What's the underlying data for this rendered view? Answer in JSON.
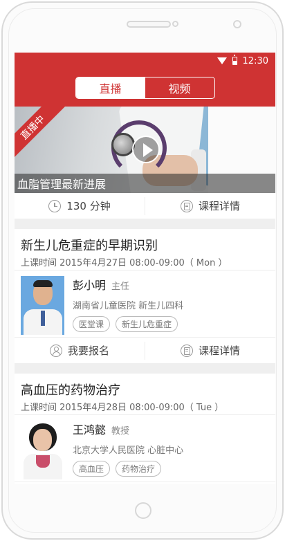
{
  "status_bar": {
    "time": "12:30"
  },
  "header": {
    "tabs": [
      {
        "label": "直播"
      },
      {
        "label": "视频"
      }
    ]
  },
  "banner": {
    "live_badge": "直播中",
    "caption": "血脂管理最新进展"
  },
  "banner_actions": {
    "duration": "130 分钟",
    "details": "课程详情"
  },
  "courses": [
    {
      "title": "新生儿危重症的早期识别",
      "time": "上课时间 2015年4月27日  08:00-09:00（ Mon ）",
      "doctor": {
        "name": "彭小明",
        "rank": "主任",
        "org": "湖南省儿童医院   新生儿四科"
      },
      "tags": [
        "医堂课",
        "新生儿危重症"
      ],
      "actions": {
        "signup": "我要报名",
        "details": "课程详情"
      }
    },
    {
      "title": "高血压的药物治疗",
      "time": "上课时间 2015年4月28日  08:00-09:00（ Tue ）",
      "doctor": {
        "name": "王鸿懿",
        "rank": "教授",
        "org": "北京大学人民医院   心脏中心"
      },
      "tags": [
        "高血压",
        "药物治疗"
      ]
    }
  ],
  "colors": {
    "brand_red": "#cf3333",
    "gap_gray": "#efefef"
  }
}
